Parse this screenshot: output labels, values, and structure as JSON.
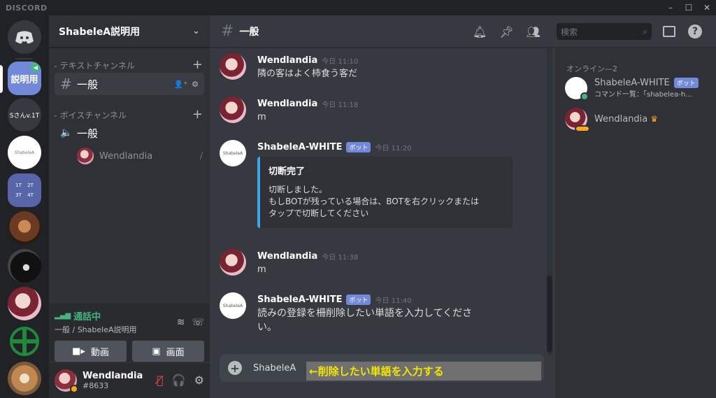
{
  "titlebar": {
    "brand": "DISCORD"
  },
  "guilds": [
    {
      "name": "discord-home",
      "label": ""
    },
    {
      "name": "server-shabelea",
      "label": "説明用",
      "voice": true,
      "selected": true
    },
    {
      "name": "server-s-san",
      "label": "Sさんv.1T"
    },
    {
      "name": "server-shabelea-white",
      "label": "ShabeleA"
    },
    {
      "name": "server-folder-1t-4t",
      "label": "1T 2T 3T 4T"
    },
    {
      "name": "server-lion",
      "label": ""
    },
    {
      "name": "server-dark",
      "label": ""
    },
    {
      "name": "server-wendlandia",
      "label": ""
    },
    {
      "name": "server-green",
      "label": ""
    },
    {
      "name": "server-dog",
      "label": ""
    }
  ],
  "server": {
    "name": "ShabeleA説明用"
  },
  "categories": {
    "text": "テキストチャンネル",
    "voice": "ボイスチャンネル"
  },
  "channels": {
    "text_active": "一般",
    "voice": "一般"
  },
  "voice_users": [
    "Wendlandia"
  ],
  "voice_panel": {
    "status": "通話中",
    "location": "一般 / ShabeleA説明用",
    "video_label": "動画",
    "screen_label": "画面"
  },
  "user": {
    "name": "Wendlandia",
    "tag": "#8633"
  },
  "chat": {
    "channel": "一般"
  },
  "messages": [
    {
      "author": "Wendlandia",
      "time": "今日 11:10",
      "text": "隣の客はよく柿食う客だ",
      "bot": false
    },
    {
      "author": "Wendlandia",
      "time": "今日 11:18",
      "text": "m",
      "bot": false
    },
    {
      "author": "ShabeleA-WHITE",
      "time": "今日 11:20",
      "text": "",
      "bot": true,
      "embed": {
        "title": "切断完了",
        "desc": "切断しました。\nもしBOTが残っている場合は、BOTを右クリックまたは\nタップで切断してください"
      }
    },
    {
      "author": "Wendlandia",
      "time": "今日 11:38",
      "text": "m",
      "bot": false
    },
    {
      "author": "ShabeleA-WHITE",
      "time": "今日 11:40",
      "text": "読みの登録を柵削除したい単語を入力してくださ\nい。",
      "bot": true
    }
  ],
  "bot_badge": "ボット",
  "composer": {
    "value": "ShabeleA"
  },
  "annotation": "←削除したい単語を入力する",
  "search": {
    "placeholder": "検索"
  },
  "members": {
    "heading": "オンライン—2",
    "list": [
      {
        "name": "ShabeleA-WHITE",
        "bot": true,
        "status": "コマンド一覧：「shabelea-h..."
      },
      {
        "name": "Wendlandia",
        "bot": false,
        "owner": true
      }
    ]
  },
  "colors": {
    "accent": "#7289da",
    "online": "#43b581",
    "idle": "#faa61a",
    "embed_bar": "#3ea6e6",
    "annotation_text": "#f3e600"
  }
}
